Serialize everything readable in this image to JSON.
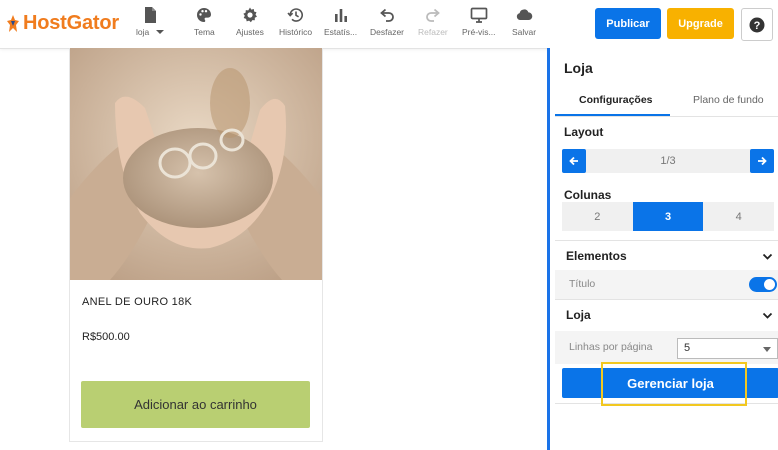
{
  "brand": {
    "name": "HostGator",
    "color": "#f07c1e"
  },
  "toolbar": {
    "page_label": "loja",
    "items": [
      {
        "label": "Tema",
        "icon": "palette-icon"
      },
      {
        "label": "Ajustes",
        "icon": "gear-icon"
      },
      {
        "label": "Histórico",
        "icon": "history-icon"
      },
      {
        "label": "Estatís...",
        "icon": "bar-chart-icon"
      },
      {
        "label": "Desfazer",
        "icon": "undo-icon"
      },
      {
        "label": "Refazer",
        "icon": "redo-icon",
        "disabled": true
      },
      {
        "label": "Pré-vis...",
        "icon": "monitor-icon"
      },
      {
        "label": "Salvar",
        "icon": "cloud-icon"
      }
    ],
    "publish_label": "Publicar",
    "upgrade_label": "Upgrade",
    "help_label": "?"
  },
  "product": {
    "name": "ANEL DE OURO 18K",
    "price": "R$500.00",
    "cart_button": "Adicionar ao carrinho",
    "image_alt": "hands-holding-sand-with-rings"
  },
  "panel": {
    "title": "Loja",
    "tabs": [
      {
        "label": "Configurações",
        "active": true
      },
      {
        "label": "Plano de fundo",
        "active": false
      }
    ],
    "layout": {
      "label": "Layout",
      "value": "1/3"
    },
    "columns": {
      "label": "Colunas",
      "options": [
        "2",
        "3",
        "4"
      ],
      "selected": "3"
    },
    "elements": {
      "label": "Elementos",
      "title_toggle_label": "Título",
      "title_toggle_on": true
    },
    "store": {
      "label": "Loja",
      "rows_label": "Linhas por página",
      "rows_value": "5",
      "manage_button": "Gerenciar loja"
    }
  },
  "colors": {
    "accent": "#0a74e8",
    "upgrade": "#f8b100",
    "cart_button": "#b9cf72",
    "highlight": "#f2c820"
  }
}
